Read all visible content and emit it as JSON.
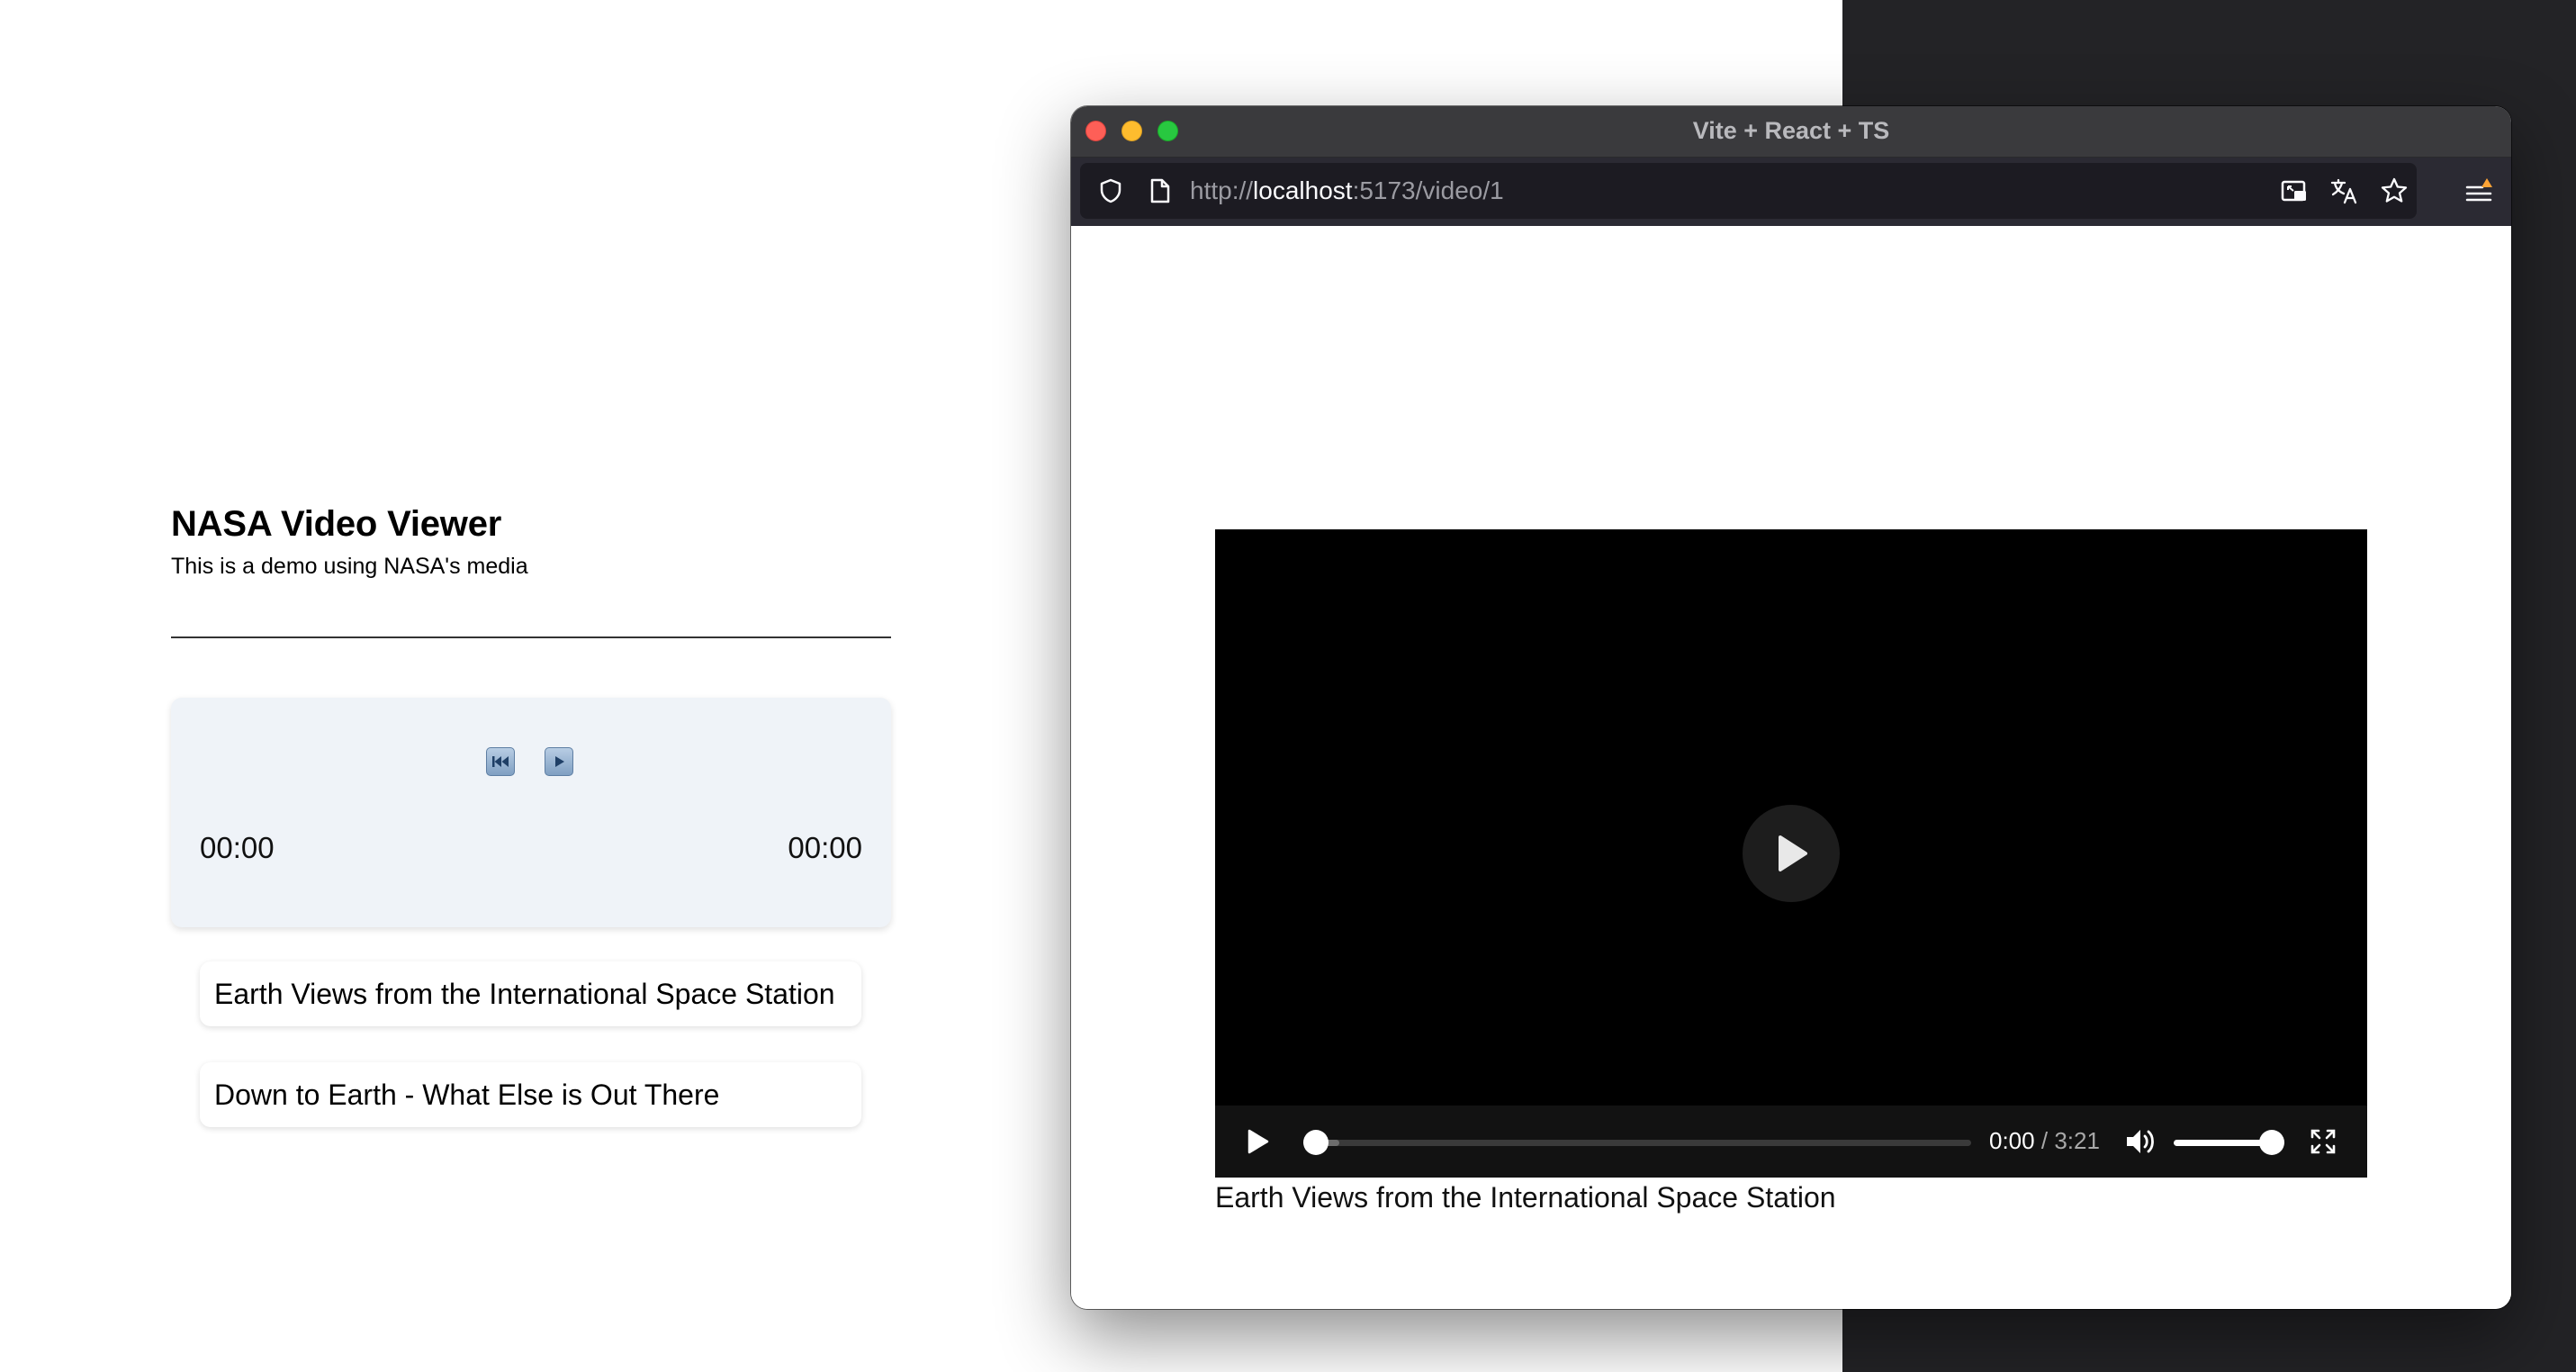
{
  "app": {
    "title": "NASA Video Viewer",
    "subtitle": "This is a demo using NASA's media",
    "player": {
      "rewind_icon": "rewind-icon",
      "play_icon": "play-icon",
      "current_time": "00:00",
      "duration": "00:00"
    },
    "videos": [
      {
        "title": "Earth Views from the International Space Station"
      },
      {
        "title": "Down to Earth - What Else is Out There"
      }
    ]
  },
  "browser": {
    "window_title": "Vite + React + TS",
    "url": {
      "scheme": "http://",
      "host": "localhost",
      "rest": ":5173/video/1"
    },
    "toolbar_icons": [
      "shield-icon",
      "page-icon",
      "picture-in-picture-icon",
      "translate-icon",
      "bookmark-star-icon",
      "menu-icon"
    ]
  },
  "page": {
    "video": {
      "current_time": "0:00",
      "separator": "/",
      "duration": "3:21",
      "progress": 0.0,
      "volume": 1.0
    },
    "caption": "Earth Views from the International Space Station"
  },
  "colors": {
    "card_bg": "#eff3f8",
    "dark_background": "#232326",
    "browser_toolbar": "#2b2a33",
    "traffic_red": "#fe5f57",
    "traffic_yellow": "#febc2e",
    "traffic_green": "#28c840"
  }
}
